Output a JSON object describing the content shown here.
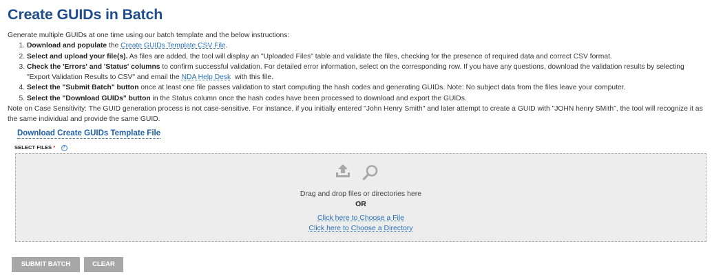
{
  "page": {
    "title": "Create GUIDs in Batch"
  },
  "instructions": {
    "intro": "Generate multiple GUIDs at one time using our batch template and the below instructions:",
    "steps": [
      {
        "bold": "Download and populate",
        "text": " the ",
        "link": "Create GUIDs Template CSV File",
        "after": "."
      },
      {
        "bold": "Select and upload your file(s).",
        "text": " As files are added, the tool will display an \"Uploaded Files\" table and validate the files, checking for the presence of required data and correct CSV format."
      },
      {
        "bold": "Check the 'Errors' and 'Status' columns",
        "text": " to confirm successful validation. For detailed error information, select on the corresponding row. If you have any questions, download the validation results by selecting \"Export Validation Results to CSV\" and email the ",
        "link": "NDA Help Desk",
        "after": "  with this file."
      },
      {
        "bold": "Select the \"Submit Batch\" button",
        "text": " once at least one file passes validation to start computing the hash codes and generating GUIDs. Note: No subject data from the files leave your computer."
      },
      {
        "bold": "Select the \"Download GUIDs\" button",
        "text": " in the Status column once the hash codes have been processed to download and export the GUIDs."
      }
    ],
    "note": "Note on Case Sensitivity: The GUID generation process is not case-sensitive. For instance, if you initially entered \"John Henry Smith\" and later attempt to create a GUID with \"JOHN henry SMith\", the tool will recognize it as the same individual and provide the same GUID."
  },
  "download_link": "Download Create GUIDs Template File",
  "select_files": {
    "label": "SELECT FILES",
    "required_mark": "*",
    "help": "?"
  },
  "dropzone": {
    "text": "Drag and drop files or directories here",
    "or": "OR",
    "choose_file": "Click here to Choose a File",
    "choose_directory": "Click here to Choose a Directory",
    "icons": [
      "upload-icon",
      "search-icon"
    ]
  },
  "buttons": {
    "submit": "SUBMIT BATCH",
    "clear": "CLEAR"
  },
  "colors": {
    "title": "#1f4e8c",
    "link": "#2a6fb5",
    "button": "#a7a7a7",
    "dropzone_bg": "#ededed"
  }
}
